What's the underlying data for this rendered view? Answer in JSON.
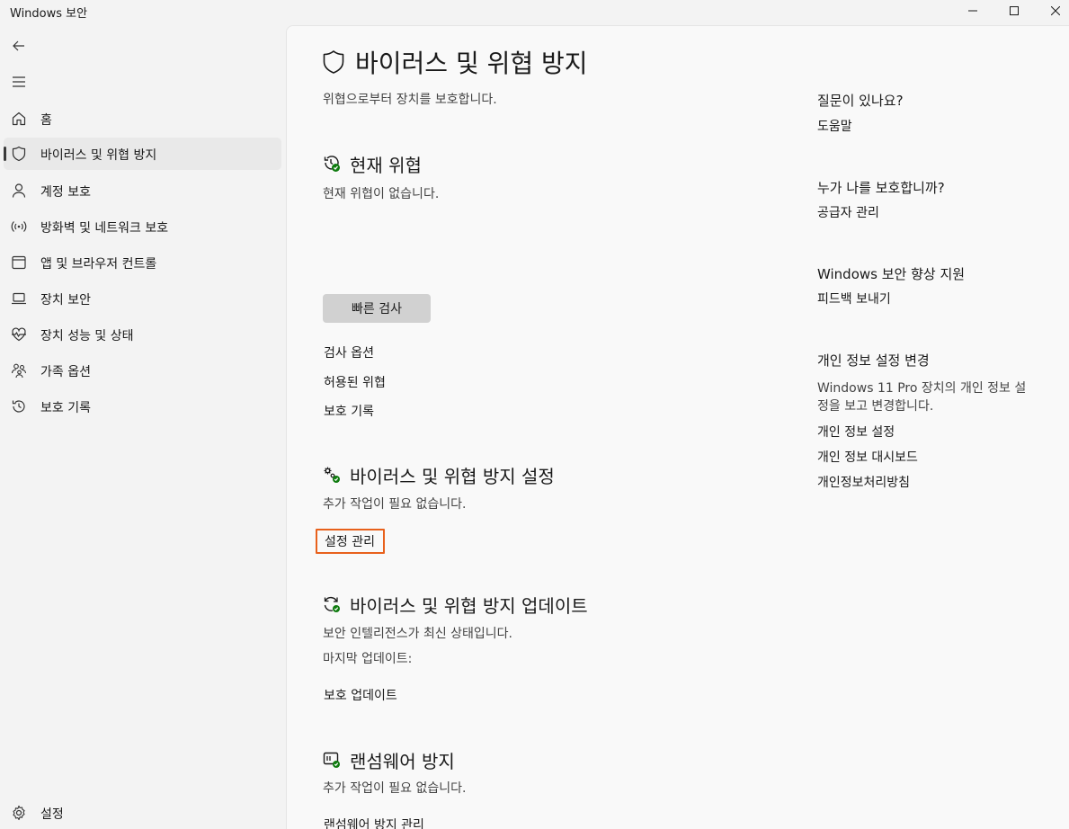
{
  "window": {
    "title": "Windows 보안"
  },
  "sidebar": {
    "items": [
      {
        "label": "홈",
        "icon": "home-icon"
      },
      {
        "label": "바이러스 및 위협 방지",
        "icon": "shield-icon"
      },
      {
        "label": "계정 보호",
        "icon": "person-icon"
      },
      {
        "label": "방화벽 및 네트워크 보호",
        "icon": "wifi-icon"
      },
      {
        "label": "앱 및 브라우저 컨트롤",
        "icon": "app-window-icon"
      },
      {
        "label": "장치 보안",
        "icon": "laptop-icon"
      },
      {
        "label": "장치 성능 및 상태",
        "icon": "heart-pulse-icon"
      },
      {
        "label": "가족 옵션",
        "icon": "family-icon"
      },
      {
        "label": "보호 기록",
        "icon": "history-icon"
      }
    ],
    "active_index": 1,
    "settings_label": "설정"
  },
  "main": {
    "title": "바이러스 및 위협 방지",
    "subtitle": "위협으로부터 장치를 보호합니다.",
    "current_threats": {
      "title": "현재 위협",
      "status": "현재 위협이 없습니다.",
      "quick_scan_button": "빠른 검사",
      "links": [
        "검사 옵션",
        "허용된 위협",
        "보호 기록"
      ]
    },
    "settings": {
      "title": "바이러스 및 위협 방지 설정",
      "status": "추가 작업이 필요 없습니다.",
      "manage_link": "설정 관리"
    },
    "updates": {
      "title": "바이러스 및 위협 방지 업데이트",
      "status": "보안 인텔리전스가 최신 상태입니다.",
      "last_update": "마지막 업데이트:",
      "link": "보호 업데이트"
    },
    "ransomware": {
      "title": "랜섬웨어 방지",
      "status": "추가 작업이 필요 없습니다.",
      "link": "랜섬웨어 방지 관리"
    }
  },
  "right_panel": {
    "help": {
      "heading": "질문이 있나요?",
      "link": "도움말"
    },
    "who": {
      "heading": "누가 나를 보호합니까?",
      "link": "공급자 관리"
    },
    "improve": {
      "heading": "Windows 보안 향상 지원",
      "link": "피드백 보내기"
    },
    "privacy": {
      "heading": "개인 정보 설정 변경",
      "text": "Windows 11 Pro 장치의 개인 정보 설정을 보고 변경합니다.",
      "links": [
        "개인 정보 설정",
        "개인 정보 대시보드",
        "개인정보처리방침"
      ]
    }
  },
  "colors": {
    "accent_status": "#107c10",
    "highlight": "#e8611c"
  }
}
